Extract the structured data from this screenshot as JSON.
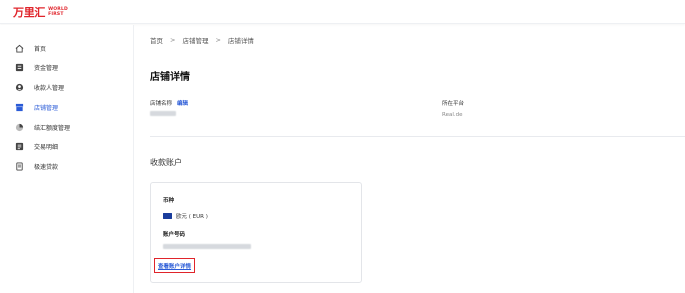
{
  "brand": {
    "name_cn": "万里汇",
    "name_en_line1": "WORLD",
    "name_en_line2": "FIRST"
  },
  "sidebar": {
    "items": [
      {
        "label": "首页",
        "icon": "home-icon",
        "active": false
      },
      {
        "label": "资金管理",
        "icon": "wallet-icon",
        "active": false
      },
      {
        "label": "收款人管理",
        "icon": "user-icon",
        "active": false
      },
      {
        "label": "店铺管理",
        "icon": "store-icon",
        "active": true
      },
      {
        "label": "结汇额度管理",
        "icon": "quota-icon",
        "active": false
      },
      {
        "label": "交易明细",
        "icon": "transaction-icon",
        "active": false
      },
      {
        "label": "极速贷款",
        "icon": "loan-icon",
        "active": false
      }
    ]
  },
  "breadcrumb": {
    "items": [
      "首页",
      "店铺管理",
      "店铺详情"
    ],
    "separator": ">"
  },
  "page": {
    "title": "店铺详情"
  },
  "store": {
    "name_label": "店铺名称",
    "edit_label": "编辑",
    "platform_label": "所在平台",
    "platform_value": "Real.de"
  },
  "account_section": {
    "title": "收款账户",
    "currency_label": "币种",
    "currency_value": "欧元 ( EUR )",
    "account_number_label": "账户号码",
    "view_detail_label": "查看账户详情"
  },
  "colors": {
    "accent": "#2a5bd7",
    "brand_red": "#e0242b",
    "flag_blue": "#1a3d9c"
  }
}
